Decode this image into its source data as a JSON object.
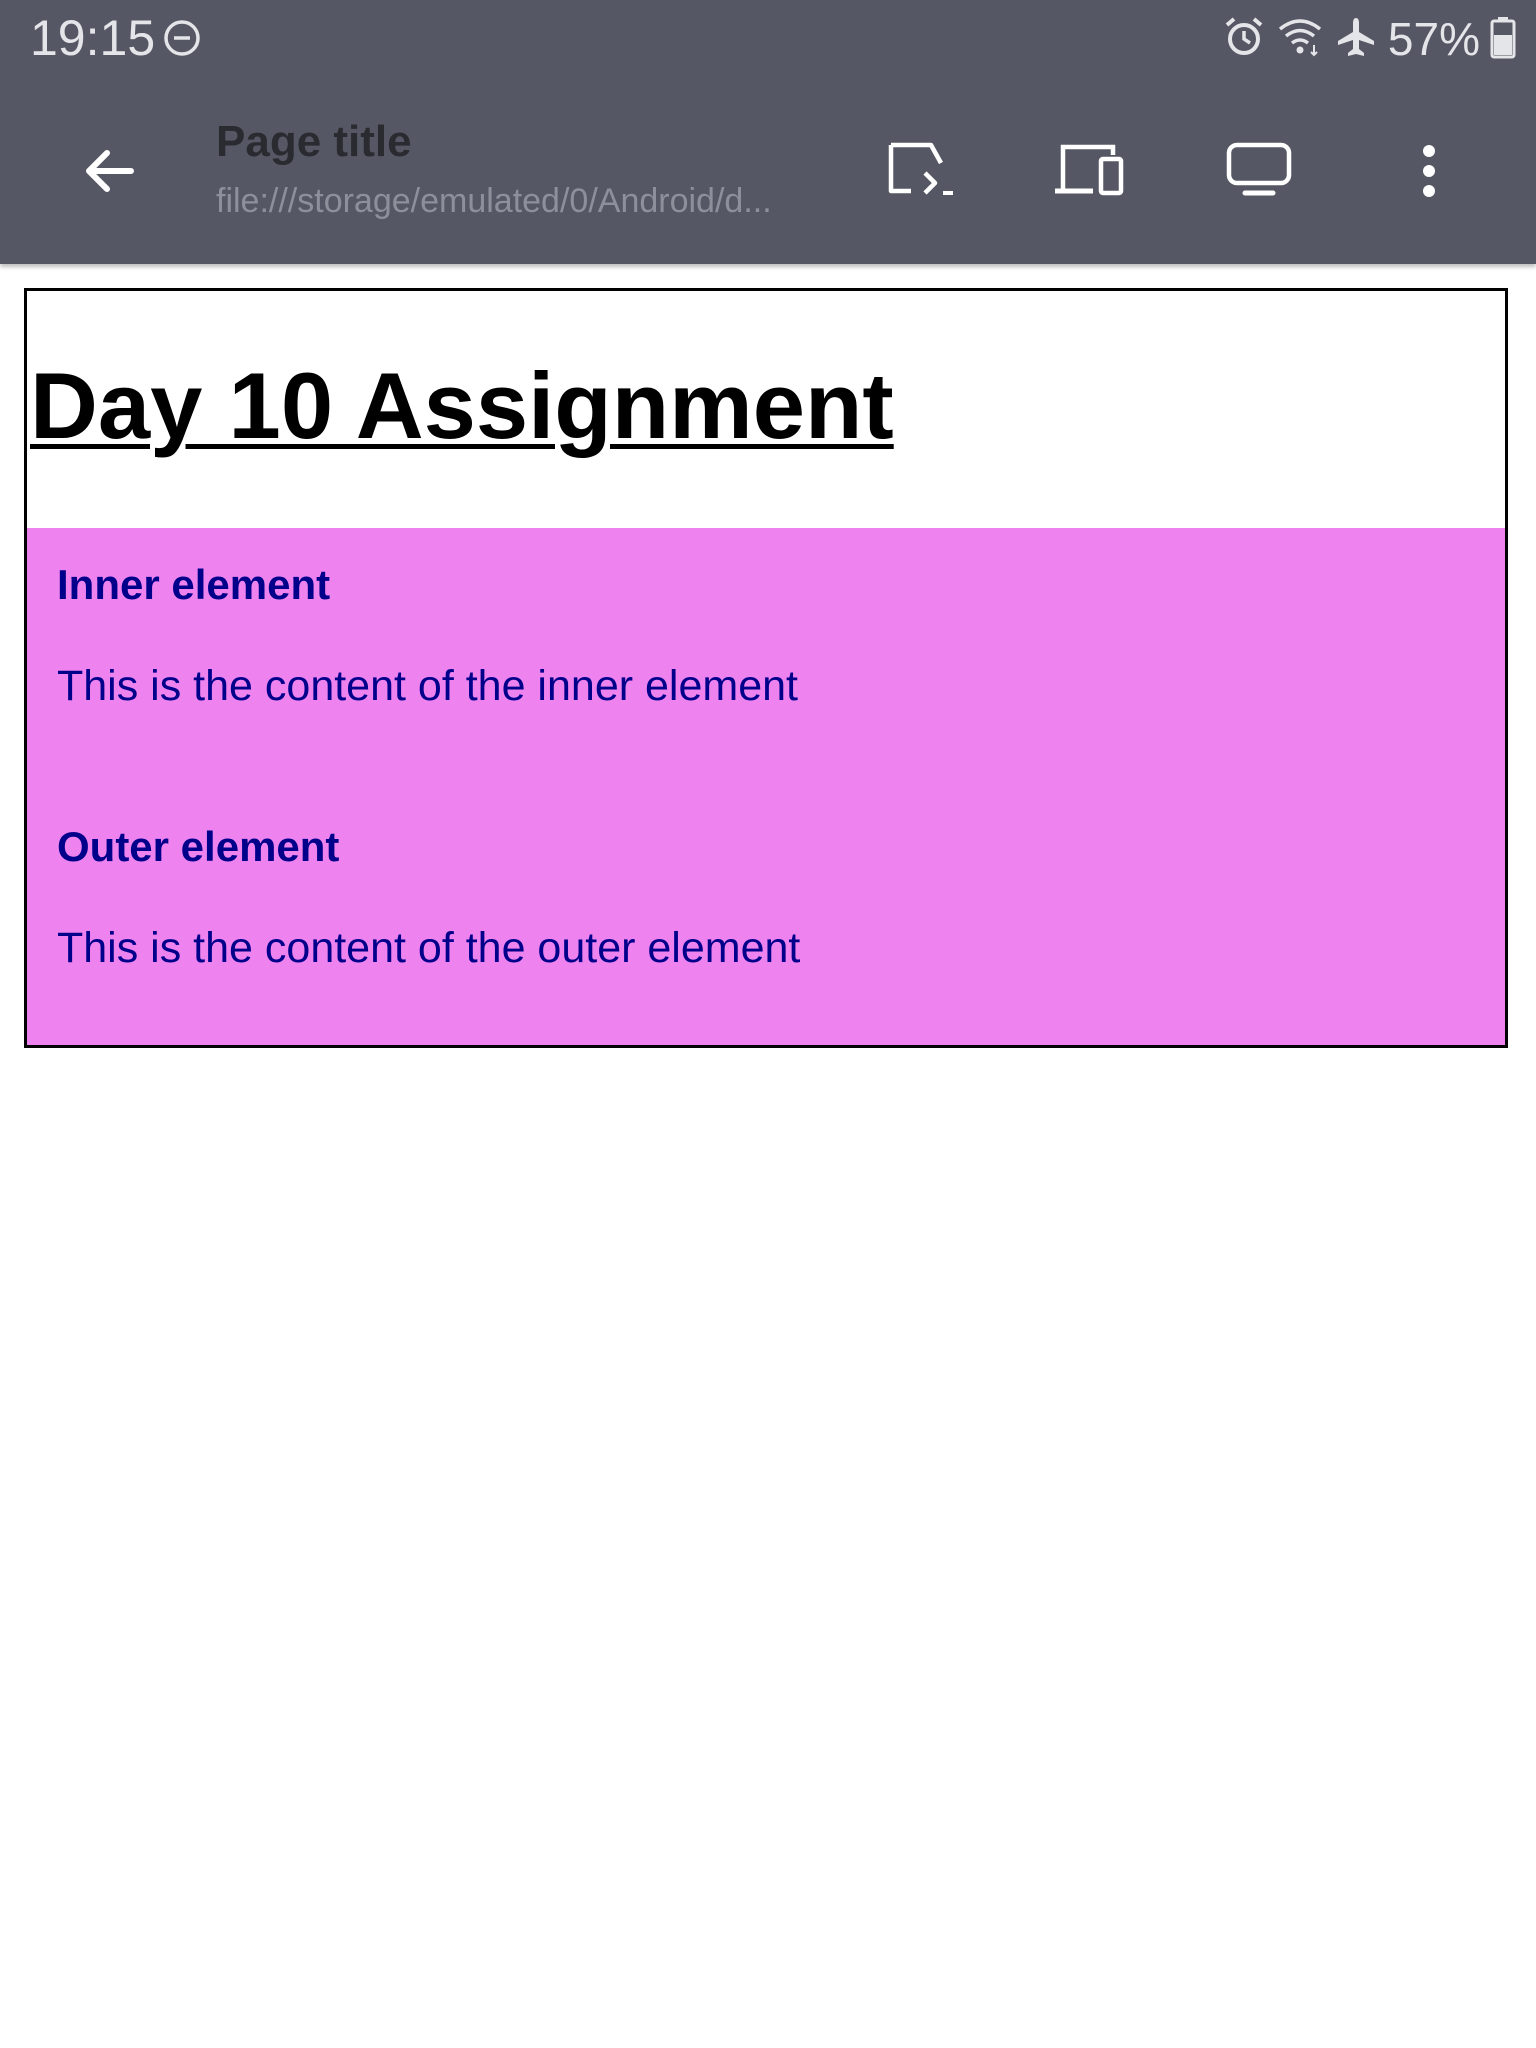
{
  "status_bar": {
    "time": "19:15",
    "battery": "57%",
    "icons": [
      "do-not-disturb-icon",
      "alarm-icon",
      "wifi-icon",
      "airplane-mode-icon",
      "battery-icon"
    ]
  },
  "toolbar": {
    "title": "Page title",
    "url": "file:///storage/emulated/0/Android/d...",
    "icons": [
      "back-arrow-icon",
      "cast-icon",
      "devices-icon",
      "monitor-icon",
      "more-vert-icon"
    ]
  },
  "page": {
    "heading": "Day 10 Assignment",
    "sections": [
      {
        "title": "Inner element",
        "text": "This is the content of the inner element"
      },
      {
        "title": "Outer element",
        "text": "This is the content of the outer element"
      }
    ]
  },
  "colors": {
    "bar_background": "#555864",
    "panel_background": "#ee82ee",
    "panel_text": "#00008b"
  }
}
